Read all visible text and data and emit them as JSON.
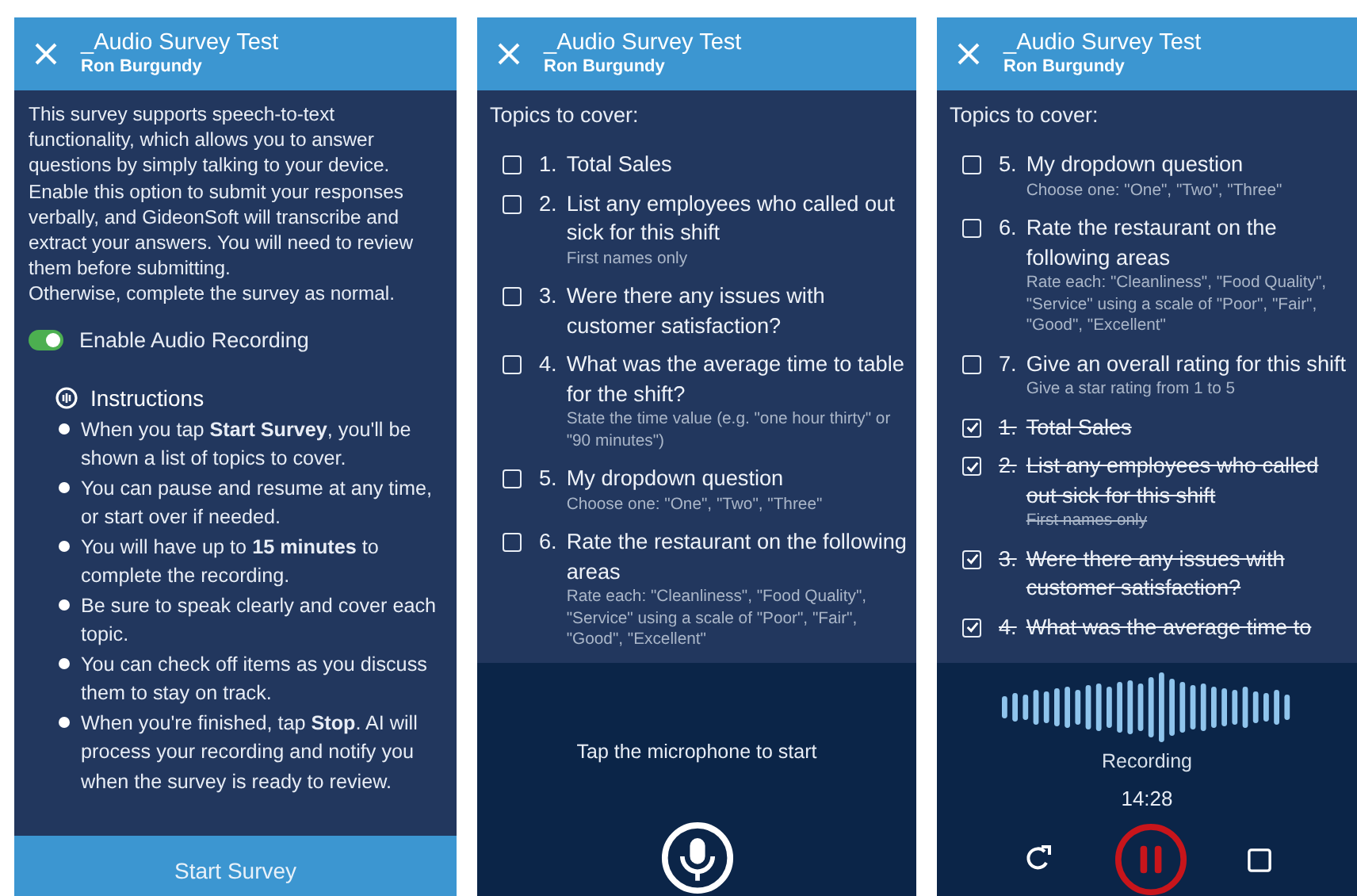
{
  "screens": [
    {
      "kind": "intro",
      "header": {
        "title": "_Audio Survey Test",
        "subtitle": "Ron Burgundy"
      },
      "intro": [
        "This survey supports speech-to-text functionality, which allows you to answer questions by simply talking to your device. Enable this option to submit your responses verbally, and GideonSoft will transcribe and extract your answers. You will need to review them before submitting.",
        "Otherwise, complete the survey as normal."
      ],
      "toggle": {
        "label": "Enable Audio Recording",
        "on": true
      },
      "instructions": {
        "title": "Instructions",
        "items": [
          "When you tap **Start Survey**, you'll be shown a list of topics to cover.",
          "You can pause and resume at any time, or start over if needed.",
          "You will have up to **15 minutes** to complete the recording.",
          "Be sure to speak clearly and cover each topic.",
          "You can check off items as you discuss them to stay on track.",
          "When you're finished, tap **Stop**. AI will process your recording and notify you when the survey is ready to review."
        ]
      },
      "button": "Start Survey"
    },
    {
      "kind": "topics",
      "header": {
        "title": "_Audio Survey Test",
        "subtitle": "Ron Burgundy"
      },
      "heading": "Topics to cover:",
      "topics": [
        {
          "number": "1.",
          "text": "Total Sales",
          "checked": false
        },
        {
          "number": "2.",
          "text": "List any employees who called out sick for this shift",
          "hint": "First names only",
          "checked": false
        },
        {
          "number": "3.",
          "text": "Were there any issues with customer satisfaction?",
          "checked": false
        },
        {
          "number": "4.",
          "text": "What was the average time to table for the shift?",
          "hint": "State the time value (e.g. \"one hour thirty\" or \"90 minutes\")",
          "checked": false
        },
        {
          "number": "5.",
          "text": "My dropdown question",
          "hint": "Choose one: \"One\", \"Two\", \"Three\"",
          "checked": false
        },
        {
          "number": "6.",
          "text": "Rate the restaurant on the following areas",
          "hint": "Rate each: \"Cleanliness\", \"Food Quality\", \"Service\" using a scale of \"Poor\", \"Fair\", \"Good\", \"Excellent\"",
          "checked": false
        }
      ],
      "footer": {
        "kind": "idle",
        "prompt": "Tap the microphone to start"
      }
    },
    {
      "kind": "topics",
      "header": {
        "title": "_Audio Survey Test",
        "subtitle": "Ron Burgundy"
      },
      "heading": "Topics to cover:",
      "topics": [
        {
          "number": "5.",
          "text": "My dropdown question",
          "hint": "Choose one: \"One\", \"Two\", \"Three\"",
          "checked": false
        },
        {
          "number": "6.",
          "text": "Rate the restaurant on the following areas",
          "hint": "Rate each: \"Cleanliness\", \"Food Quality\", \"Service\" using a scale of \"Poor\", \"Fair\", \"Good\", \"Excellent\"",
          "checked": false
        },
        {
          "number": "7.",
          "text": "Give an overall rating for this shift",
          "hint": "Give a star rating from 1 to 5",
          "checked": false
        },
        {
          "number": "1.",
          "text": "Total Sales",
          "checked": true
        },
        {
          "number": "2.",
          "text": "List any employees who called out sick for this shift",
          "hint": "First names only",
          "checked": true
        },
        {
          "number": "3.",
          "text": "Were there any issues with customer satisfaction?",
          "checked": true
        },
        {
          "number": "4.",
          "text": "What was the average time to",
          "checked": true
        }
      ],
      "footer": {
        "kind": "recording",
        "status": "Recording",
        "time": "14:28"
      }
    }
  ]
}
